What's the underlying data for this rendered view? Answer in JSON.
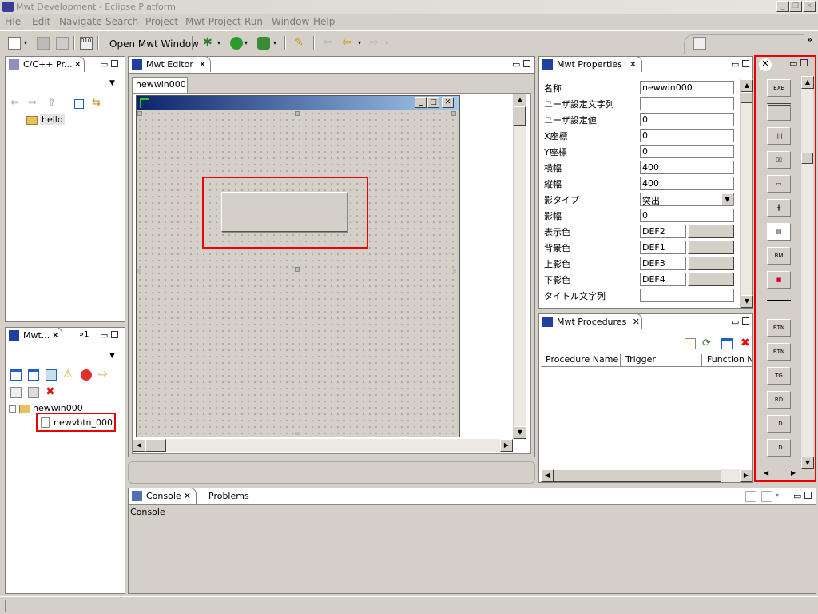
{
  "window": {
    "title": "Mwt Development - Eclipse Platform"
  },
  "menu": [
    "File",
    "Edit",
    "Navigate",
    "Search",
    "Project",
    "Mwt Project",
    "Run",
    "Window",
    "Help"
  ],
  "toolbar": {
    "open_mwt_window": "Open Mwt Window"
  },
  "cproject_panel": {
    "tab": "C/C++ Pr...",
    "tree": [
      "hello"
    ]
  },
  "mwt_panel": {
    "tab": "Mwt...",
    "overflow": "»1",
    "tree_root": "newwin000",
    "tree_child": "newvbtn_000"
  },
  "editor": {
    "tab": "Mwt Editor",
    "subtab": "newwin000"
  },
  "properties": {
    "tab": "Mwt Properties",
    "rows": [
      {
        "label": "名称",
        "value": "newwin000"
      },
      {
        "label": "ユーザ設定文字列",
        "value": ""
      },
      {
        "label": "ユーザ設定値",
        "value": "0"
      },
      {
        "label": "X座標",
        "value": "0"
      },
      {
        "label": "Y座標",
        "value": "0"
      },
      {
        "label": "横幅",
        "value": "400"
      },
      {
        "label": "縦幅",
        "value": "400"
      },
      {
        "label": "影タイプ",
        "value": "突出"
      },
      {
        "label": "影幅",
        "value": "0"
      },
      {
        "label": "表示色",
        "value": "DEF2"
      },
      {
        "label": "背景色",
        "value": "DEF1"
      },
      {
        "label": "上影色",
        "value": "DEF3"
      },
      {
        "label": "下影色",
        "value": "DEF4"
      },
      {
        "label": "タイトル文字列",
        "value": ""
      }
    ]
  },
  "procedures": {
    "tab": "Mwt Procedures",
    "columns": [
      "Procedure Name",
      "Trigger",
      "Function Na"
    ]
  },
  "palette": {
    "items": [
      "EXE",
      "",
      "",
      "",
      "",
      "",
      "",
      "BM",
      "",
      "",
      "BTN",
      "BTN",
      "TG",
      "RD",
      "LD",
      "LD"
    ]
  },
  "console": {
    "tab": "Console",
    "tab2": "Problems",
    "label": "Console"
  }
}
